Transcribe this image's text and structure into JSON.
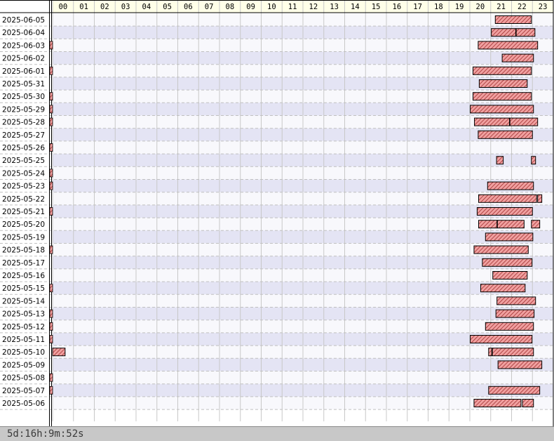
{
  "chart_data": {
    "type": "timeline",
    "hours": [
      "00",
      "01",
      "02",
      "03",
      "04",
      "05",
      "06",
      "07",
      "08",
      "09",
      "10",
      "11",
      "12",
      "13",
      "14",
      "15",
      "16",
      "17",
      "18",
      "19",
      "20",
      "21",
      "22",
      "23"
    ],
    "rows": [
      {
        "date": "2025-06-05",
        "segments": [
          [
            21.22,
            22.95
          ]
        ]
      },
      {
        "date": "2025-06-04",
        "segments": [
          [
            21.03,
            22.2
          ],
          [
            22.22,
            23.12
          ]
        ]
      },
      {
        "date": "2025-06-03",
        "segments": [
          [
            20.4,
            23.25
          ]
        ]
      },
      {
        "date": "2025-06-02",
        "segments": [
          [
            21.55,
            23.05
          ]
        ]
      },
      {
        "date": "2025-06-01",
        "segments": [
          [
            20.15,
            22.95
          ]
        ]
      },
      {
        "date": "2025-05-31",
        "segments": [
          [
            20.45,
            22.75
          ]
        ]
      },
      {
        "date": "2025-05-30",
        "segments": [
          [
            20.15,
            22.95
          ]
        ]
      },
      {
        "date": "2025-05-29",
        "segments": [
          [
            20.02,
            23.05
          ]
        ]
      },
      {
        "date": "2025-05-28",
        "segments": [
          [
            20.22,
            21.9
          ],
          [
            21.92,
            23.25
          ]
        ]
      },
      {
        "date": "2025-05-27",
        "segments": [
          [
            20.4,
            23.0
          ]
        ]
      },
      {
        "date": "2025-05-26",
        "segments": []
      },
      {
        "date": "2025-05-25",
        "segments": [
          [
            21.28,
            21.6
          ],
          [
            22.95,
            23.15
          ]
        ]
      },
      {
        "date": "2025-05-24",
        "segments": []
      },
      {
        "date": "2025-05-23",
        "segments": [
          [
            20.85,
            23.05
          ]
        ]
      },
      {
        "date": "2025-05-22",
        "segments": [
          [
            20.42,
            23.2
          ],
          [
            23.25,
            23.45
          ]
        ]
      },
      {
        "date": "2025-05-21",
        "segments": [
          [
            20.35,
            23.0
          ]
        ]
      },
      {
        "date": "2025-05-20",
        "segments": [
          [
            20.42,
            21.3
          ],
          [
            21.32,
            22.6
          ],
          [
            22.95,
            23.35
          ]
        ]
      },
      {
        "date": "2025-05-19",
        "segments": [
          [
            20.75,
            23.02
          ]
        ]
      },
      {
        "date": "2025-05-18",
        "segments": [
          [
            20.2,
            22.8
          ]
        ]
      },
      {
        "date": "2025-05-17",
        "segments": [
          [
            20.6,
            22.98
          ]
        ]
      },
      {
        "date": "2025-05-16",
        "segments": [
          [
            21.1,
            22.75
          ]
        ]
      },
      {
        "date": "2025-05-15",
        "segments": [
          [
            20.52,
            22.65
          ]
        ]
      },
      {
        "date": "2025-05-14",
        "segments": [
          [
            21.3,
            23.15
          ]
        ]
      },
      {
        "date": "2025-05-13",
        "segments": [
          [
            21.25,
            23.08
          ]
        ]
      },
      {
        "date": "2025-05-12",
        "segments": [
          [
            20.75,
            23.05
          ]
        ]
      },
      {
        "date": "2025-05-11",
        "segments": [
          [
            20.02,
            22.98
          ]
        ]
      },
      {
        "date": "2025-05-10",
        "segments": [
          [
            0.0,
            0.6
          ],
          [
            20.9,
            21.05
          ],
          [
            21.08,
            23.05
          ]
        ]
      },
      {
        "date": "2025-05-09",
        "segments": [
          [
            21.35,
            23.45
          ]
        ]
      },
      {
        "date": "2025-05-08",
        "segments": []
      },
      {
        "date": "2025-05-07",
        "segments": [
          [
            20.9,
            23.35
          ]
        ]
      },
      {
        "date": "2025-05-06",
        "segments": [
          [
            20.2,
            22.45
          ],
          [
            22.52,
            23.05
          ]
        ]
      }
    ],
    "midnight_marker_dates": [
      "2025-06-03",
      "2025-06-01",
      "2025-05-30",
      "2025-05-29",
      "2025-05-28",
      "2025-05-26",
      "2025-05-24",
      "2025-05-23",
      "2025-05-21",
      "2025-05-18",
      "2025-05-15",
      "2025-05-13",
      "2025-05-12",
      "2025-05-11",
      "2025-05-08",
      "2025-05-07"
    ],
    "colors": {
      "bar_fill": "#f0a0a0",
      "bar_hatch": "#a03030",
      "bar_border": "#000000",
      "row_band": "#e4e4f4",
      "row_plain": "#f8f8fc",
      "header_bg": "#ffffe8",
      "grid": "#c8c8c8"
    }
  },
  "footer": {
    "uptime": "5d:16h:9m:52s"
  }
}
